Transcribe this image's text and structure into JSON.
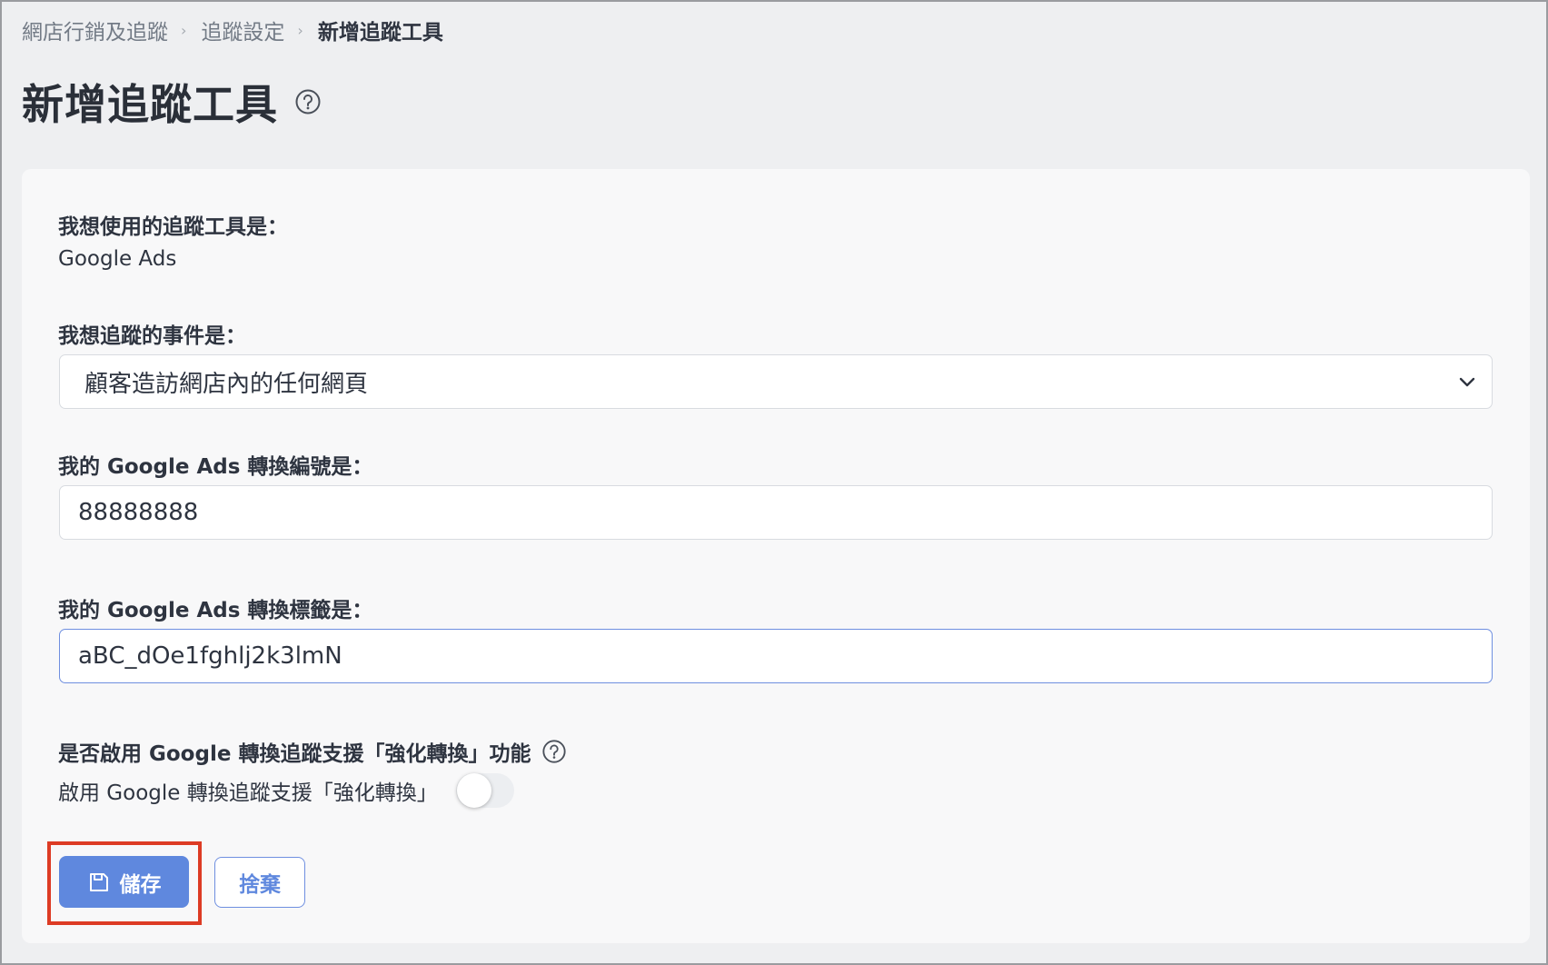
{
  "breadcrumb": {
    "items": [
      "網店行銷及追蹤",
      "追蹤設定"
    ],
    "current": "新增追蹤工具"
  },
  "page": {
    "title": "新增追蹤工具"
  },
  "form": {
    "tool": {
      "label": "我想使用的追蹤工具是：",
      "value": "Google Ads"
    },
    "event": {
      "label": "我想追蹤的事件是：",
      "selected": "顧客造訪網店內的任何網頁"
    },
    "conversion_id": {
      "label": "我的 Google Ads 轉換編號是：",
      "value": "88888888"
    },
    "conversion_label": {
      "label": "我的 Google Ads 轉換標籤是：",
      "value": "aBC_dOe1fghlj2k3lmN"
    },
    "enhanced": {
      "label": "是否啟用 Google 轉換追蹤支援「強化轉換」功能",
      "toggle_label": "啟用 Google 轉換追蹤支援「強化轉換」",
      "enabled": false
    }
  },
  "actions": {
    "save_label": "儲存",
    "discard_label": "捨棄"
  },
  "colors": {
    "primary": "#5f88de",
    "highlight": "#dd3b24",
    "background": "#eeeff1",
    "card": "#f8f8f9"
  }
}
